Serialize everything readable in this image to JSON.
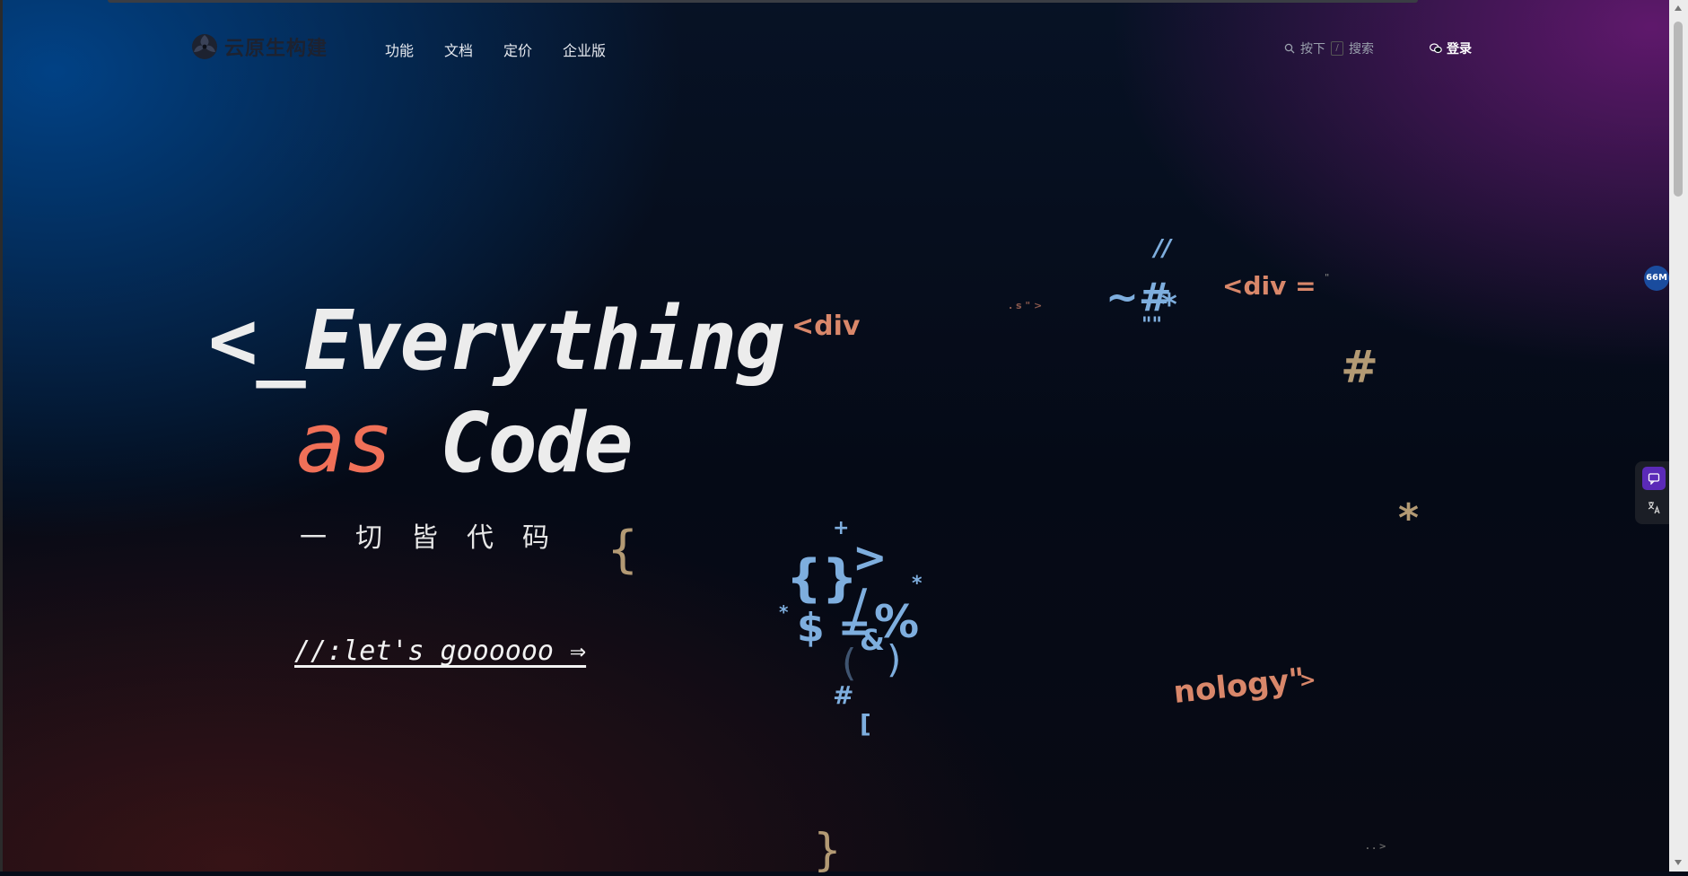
{
  "brand": {
    "name": "云原生构建",
    "logo_icon": "cloud-native-logo-icon"
  },
  "nav": {
    "items": [
      {
        "label": "功能"
      },
      {
        "label": "文档"
      },
      {
        "label": "定价"
      },
      {
        "label": "企业版"
      }
    ],
    "search": {
      "prefix": "按下",
      "key": "/",
      "label": "搜索",
      "icon": "search-icon"
    },
    "login": {
      "label": "登录",
      "icon": "wechat-icon"
    }
  },
  "hero": {
    "line1": "<_Everything",
    "as_word": "as",
    "code_word": "Code",
    "subtitle": "一切皆代码",
    "cta": "//:let's goooooo ⇒"
  },
  "floating_text": {
    "div1": "<div",
    "div2": "<div =",
    "slashes": "//",
    "tilde_hash": "~#",
    "star": "*",
    "quotes": "\"\"",
    "hash_tan": "#",
    "star_tan": "*",
    "brace_open": "{",
    "plus": "+",
    "gt": ">",
    "braces": "{}",
    "star2": "*",
    "star3": "*",
    "dollar_eq": "$ =",
    "slash": "/",
    "percent": "%",
    "amp": "&",
    "paren_open": "(",
    "paren_close": ")",
    "hash_blue": "#",
    "bracket": "[",
    "brace_close": "}",
    "technology": "nology\"",
    "tech_gt": ">",
    "tiny_seq": ". s \" >",
    "bottom_tiny": ". . >",
    "quote_tiny": "\""
  },
  "widgets": {
    "memory_badge": "66M",
    "tool1_icon": "chat-feedback-icon",
    "tool2_icon": "translate-icon"
  },
  "colors": {
    "accent_orange": "#f07058",
    "symbol_blue": "#7eaede",
    "symbol_orange": "#d9876a",
    "symbol_tan": "#b39a74"
  }
}
